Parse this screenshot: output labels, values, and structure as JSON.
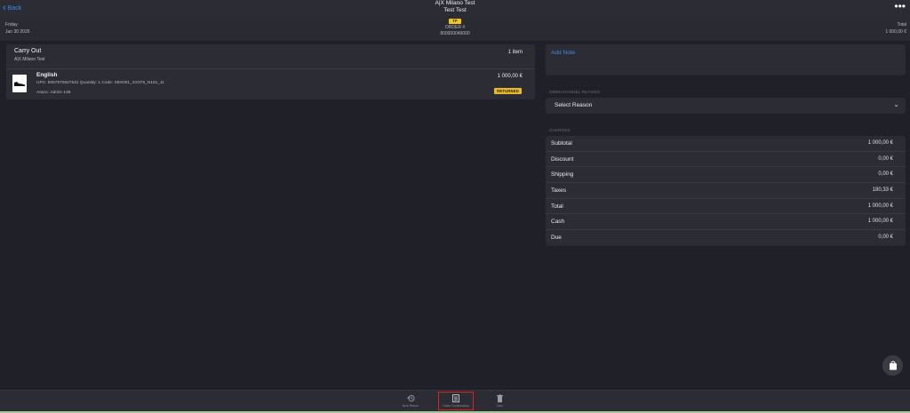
{
  "header": {
    "back_label": "Back",
    "store_name": "A|X Milano Test",
    "customer_name": "Test Test"
  },
  "subheader": {
    "day": "Friday",
    "date": "Jan 30 2026",
    "order_badge": "TF",
    "order_label": "ORDER #",
    "order_number": "800000049000",
    "total_label": "Total",
    "total_value": "1 000,00 €"
  },
  "order_card": {
    "title": "Carry Out",
    "store": "A|X Milano Test",
    "item_count": "1 item",
    "item": {
      "name": "English",
      "detail": "UPC: 8057970627531 Quantity: 1 Code: XBX001_XX375_N181_11",
      "assoc": "Assoc: Admin 136",
      "price": "1 000,00 €",
      "status": "RETURNED"
    }
  },
  "note": {
    "link_label": "Add Note"
  },
  "reason": {
    "section_label": "OMNICHANNEL REASON",
    "placeholder": "Select Reason"
  },
  "charges": {
    "section_label": "CHARGES",
    "rows": [
      {
        "label": "Subtotal",
        "value": "1 000,00 €"
      },
      {
        "label": "Discount",
        "value": "0,00 €"
      },
      {
        "label": "Shipping",
        "value": "0,00 €"
      },
      {
        "label": "Taxes",
        "value": "180,33 €"
      },
      {
        "label": "Total",
        "value": "1 000,00 €"
      },
      {
        "label": "Cash",
        "value": "1 000,00 €"
      },
      {
        "label": "Due",
        "value": "0,00 €"
      }
    ]
  },
  "bottom_tabs": [
    {
      "label": "New Return",
      "icon": "history-icon"
    },
    {
      "label": "Order Confirmation",
      "icon": "receipt-icon"
    },
    {
      "label": "Void",
      "icon": "trash-icon"
    }
  ],
  "colors": {
    "accent": "#3b8de4",
    "badge_yellow": "#f2c80f",
    "returned": "#e9b92a",
    "highlight": "#e0211b"
  }
}
